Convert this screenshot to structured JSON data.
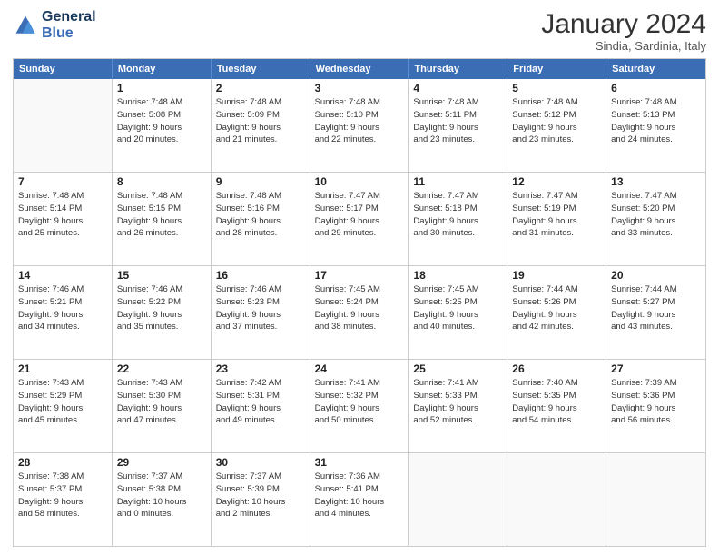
{
  "logo": {
    "text_general": "General",
    "text_blue": "Blue"
  },
  "title": "January 2024",
  "subtitle": "Sindia, Sardinia, Italy",
  "header_days": [
    "Sunday",
    "Monday",
    "Tuesday",
    "Wednesday",
    "Thursday",
    "Friday",
    "Saturday"
  ],
  "weeks": [
    [
      {
        "day": "",
        "info": ""
      },
      {
        "day": "1",
        "info": "Sunrise: 7:48 AM\nSunset: 5:08 PM\nDaylight: 9 hours\nand 20 minutes."
      },
      {
        "day": "2",
        "info": "Sunrise: 7:48 AM\nSunset: 5:09 PM\nDaylight: 9 hours\nand 21 minutes."
      },
      {
        "day": "3",
        "info": "Sunrise: 7:48 AM\nSunset: 5:10 PM\nDaylight: 9 hours\nand 22 minutes."
      },
      {
        "day": "4",
        "info": "Sunrise: 7:48 AM\nSunset: 5:11 PM\nDaylight: 9 hours\nand 23 minutes."
      },
      {
        "day": "5",
        "info": "Sunrise: 7:48 AM\nSunset: 5:12 PM\nDaylight: 9 hours\nand 23 minutes."
      },
      {
        "day": "6",
        "info": "Sunrise: 7:48 AM\nSunset: 5:13 PM\nDaylight: 9 hours\nand 24 minutes."
      }
    ],
    [
      {
        "day": "7",
        "info": "Sunrise: 7:48 AM\nSunset: 5:14 PM\nDaylight: 9 hours\nand 25 minutes."
      },
      {
        "day": "8",
        "info": "Sunrise: 7:48 AM\nSunset: 5:15 PM\nDaylight: 9 hours\nand 26 minutes."
      },
      {
        "day": "9",
        "info": "Sunrise: 7:48 AM\nSunset: 5:16 PM\nDaylight: 9 hours\nand 28 minutes."
      },
      {
        "day": "10",
        "info": "Sunrise: 7:47 AM\nSunset: 5:17 PM\nDaylight: 9 hours\nand 29 minutes."
      },
      {
        "day": "11",
        "info": "Sunrise: 7:47 AM\nSunset: 5:18 PM\nDaylight: 9 hours\nand 30 minutes."
      },
      {
        "day": "12",
        "info": "Sunrise: 7:47 AM\nSunset: 5:19 PM\nDaylight: 9 hours\nand 31 minutes."
      },
      {
        "day": "13",
        "info": "Sunrise: 7:47 AM\nSunset: 5:20 PM\nDaylight: 9 hours\nand 33 minutes."
      }
    ],
    [
      {
        "day": "14",
        "info": "Sunrise: 7:46 AM\nSunset: 5:21 PM\nDaylight: 9 hours\nand 34 minutes."
      },
      {
        "day": "15",
        "info": "Sunrise: 7:46 AM\nSunset: 5:22 PM\nDaylight: 9 hours\nand 35 minutes."
      },
      {
        "day": "16",
        "info": "Sunrise: 7:46 AM\nSunset: 5:23 PM\nDaylight: 9 hours\nand 37 minutes."
      },
      {
        "day": "17",
        "info": "Sunrise: 7:45 AM\nSunset: 5:24 PM\nDaylight: 9 hours\nand 38 minutes."
      },
      {
        "day": "18",
        "info": "Sunrise: 7:45 AM\nSunset: 5:25 PM\nDaylight: 9 hours\nand 40 minutes."
      },
      {
        "day": "19",
        "info": "Sunrise: 7:44 AM\nSunset: 5:26 PM\nDaylight: 9 hours\nand 42 minutes."
      },
      {
        "day": "20",
        "info": "Sunrise: 7:44 AM\nSunset: 5:27 PM\nDaylight: 9 hours\nand 43 minutes."
      }
    ],
    [
      {
        "day": "21",
        "info": "Sunrise: 7:43 AM\nSunset: 5:29 PM\nDaylight: 9 hours\nand 45 minutes."
      },
      {
        "day": "22",
        "info": "Sunrise: 7:43 AM\nSunset: 5:30 PM\nDaylight: 9 hours\nand 47 minutes."
      },
      {
        "day": "23",
        "info": "Sunrise: 7:42 AM\nSunset: 5:31 PM\nDaylight: 9 hours\nand 49 minutes."
      },
      {
        "day": "24",
        "info": "Sunrise: 7:41 AM\nSunset: 5:32 PM\nDaylight: 9 hours\nand 50 minutes."
      },
      {
        "day": "25",
        "info": "Sunrise: 7:41 AM\nSunset: 5:33 PM\nDaylight: 9 hours\nand 52 minutes."
      },
      {
        "day": "26",
        "info": "Sunrise: 7:40 AM\nSunset: 5:35 PM\nDaylight: 9 hours\nand 54 minutes."
      },
      {
        "day": "27",
        "info": "Sunrise: 7:39 AM\nSunset: 5:36 PM\nDaylight: 9 hours\nand 56 minutes."
      }
    ],
    [
      {
        "day": "28",
        "info": "Sunrise: 7:38 AM\nSunset: 5:37 PM\nDaylight: 9 hours\nand 58 minutes."
      },
      {
        "day": "29",
        "info": "Sunrise: 7:37 AM\nSunset: 5:38 PM\nDaylight: 10 hours\nand 0 minutes."
      },
      {
        "day": "30",
        "info": "Sunrise: 7:37 AM\nSunset: 5:39 PM\nDaylight: 10 hours\nand 2 minutes."
      },
      {
        "day": "31",
        "info": "Sunrise: 7:36 AM\nSunset: 5:41 PM\nDaylight: 10 hours\nand 4 minutes."
      },
      {
        "day": "",
        "info": ""
      },
      {
        "day": "",
        "info": ""
      },
      {
        "day": "",
        "info": ""
      }
    ]
  ]
}
